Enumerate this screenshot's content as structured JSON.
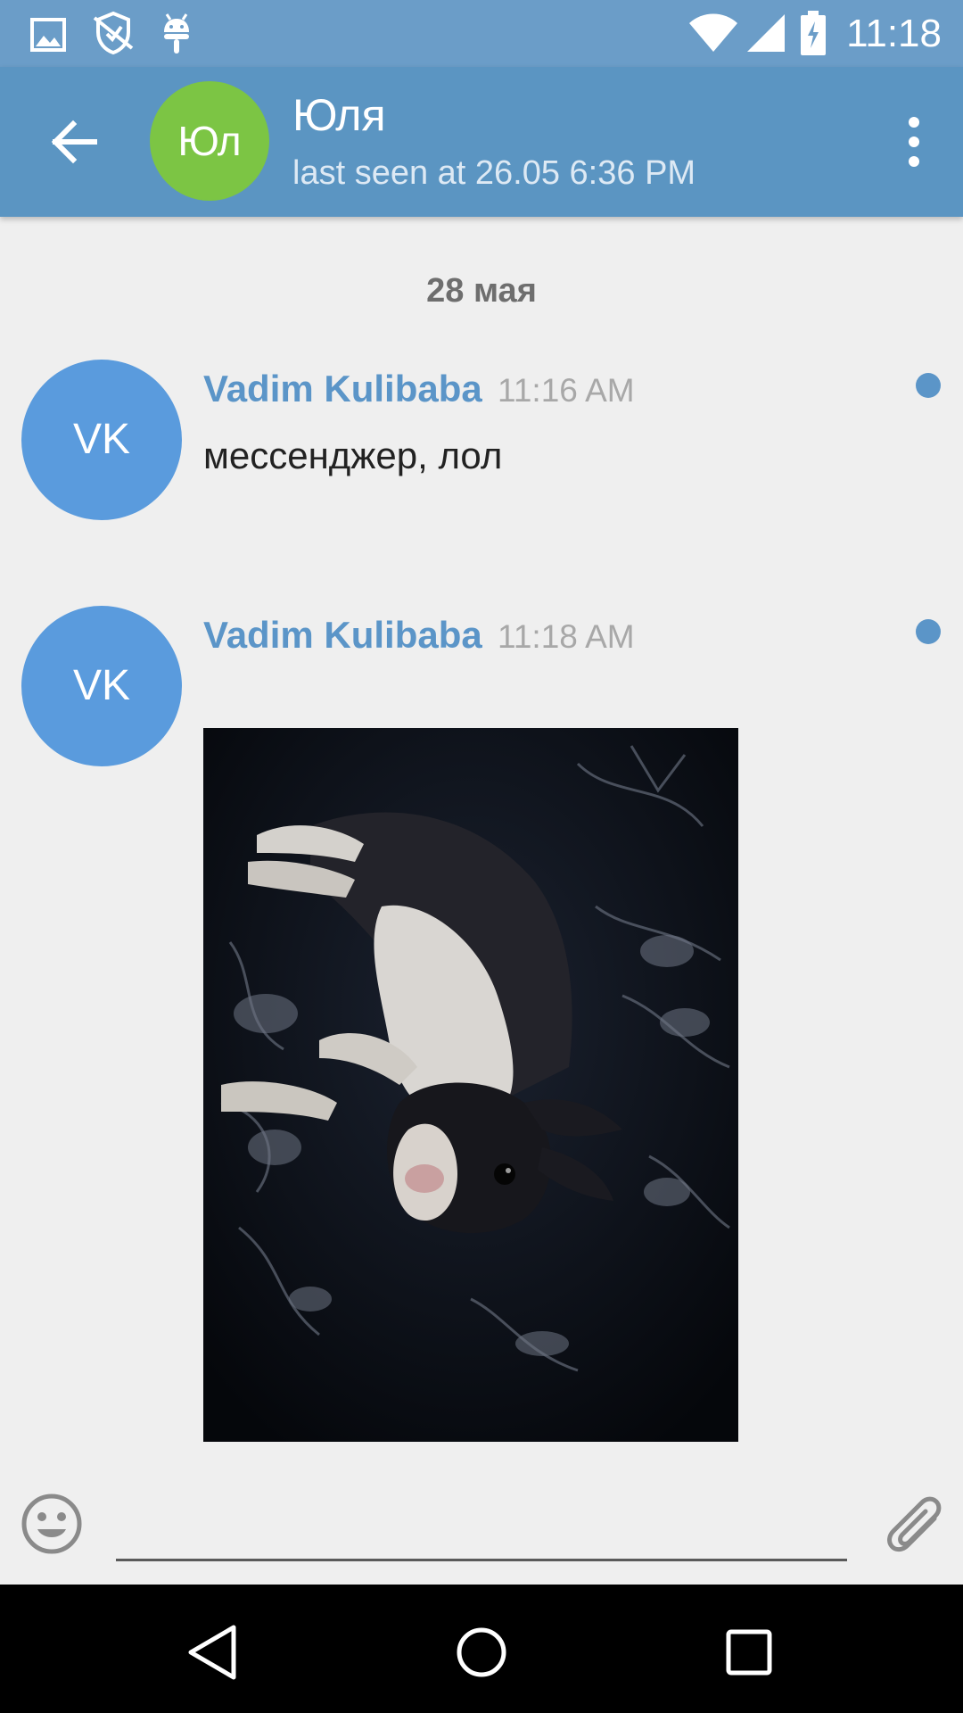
{
  "status_bar": {
    "time": "11:18",
    "icons": [
      "image-icon",
      "shield-icon",
      "android-icon",
      "wifi-icon",
      "signal-icon",
      "battery-charging-icon"
    ]
  },
  "toolbar": {
    "back_icon": "arrow-back-icon",
    "avatar_initials": "Юл",
    "avatar_color": "#7cc544",
    "title": "Юля",
    "subtitle": "last seen at 26.05 6:36 PM",
    "menu_icon": "more-vertical-icon",
    "color": "#5b95c2"
  },
  "chat": {
    "date_divider": "28 мая",
    "messages": [
      {
        "avatar_initials": "VK",
        "author": "Vadim Kulibaba",
        "time": "11:16 AM",
        "text": "мессенджер, лол",
        "unread": true
      },
      {
        "avatar_initials": "VK",
        "author": "Vadim Kulibaba",
        "time": "11:18 AM",
        "media": "photo-dog-on-bed",
        "unread": true
      }
    ],
    "accent_color": "#5b95c8"
  },
  "input_bar": {
    "emoji_icon": "emoji-icon",
    "placeholder": "",
    "attach_icon": "paperclip-icon"
  },
  "nav_bar": {
    "icons": [
      "back-triangle-icon",
      "home-circle-icon",
      "recents-square-icon"
    ]
  }
}
